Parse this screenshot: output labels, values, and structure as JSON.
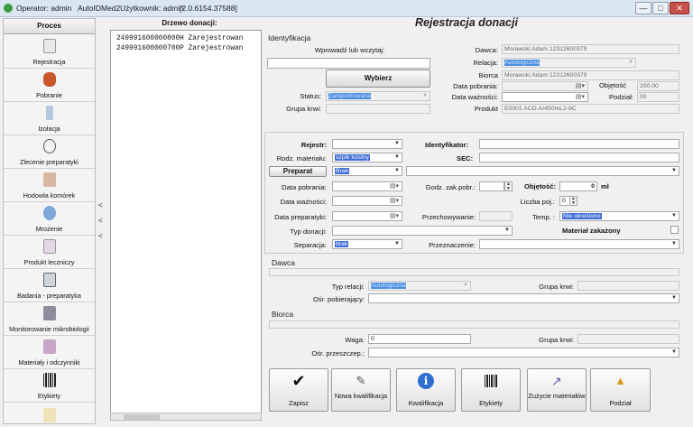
{
  "titlebar": {
    "operator": "Operator: admin",
    "app": "AutoIDMed2",
    "user": "Użytkownik: admin",
    "version": "[2.0.6154.37588]"
  },
  "sidebar": {
    "header": "Proces",
    "items": [
      {
        "label": "Rejestracja",
        "icon": "pen-icon"
      },
      {
        "label": "Pobranie",
        "icon": "blood-bag-icon"
      },
      {
        "label": "Izolacja",
        "icon": "tube-icon"
      },
      {
        "label": "Zlecenie preparatyki",
        "icon": "clock-icon"
      },
      {
        "label": "Hodowla komórek",
        "icon": "cells-icon"
      },
      {
        "label": "Mrożenie",
        "icon": "freeze-icon"
      },
      {
        "label": "Produkt leczniczy",
        "icon": "flask-icon"
      },
      {
        "label": "Badania - preparatyka",
        "icon": "microscope-icon"
      },
      {
        "label": "Monitorowanie mikrobiologii",
        "icon": "lab-icon"
      },
      {
        "label": "Materiały i odczynniki",
        "icon": "reagent-icon"
      },
      {
        "label": "Etykiety",
        "icon": "barcode-icon"
      }
    ]
  },
  "tree": {
    "title": "Drzewo donacji:",
    "items": [
      "249991600000800H Zarejestrowan",
      "249991600000700P Zarejestrowan"
    ]
  },
  "form": {
    "title": "Rejestracja donacji",
    "identification": {
      "section": "Identyfikacja",
      "scan_label": "Wprowadź lub wczytaj:",
      "choose_button": "Wybierz",
      "status_label": "Status:",
      "status_value": "Zarejestrowana",
      "blood_group_label": "Grupa krwi:",
      "donor_label": "Dawca:",
      "donor_value": "Morawski Adam 12312600379",
      "relation_label": "Relacja:",
      "relation_value": "Autologiczna",
      "recipient_label": "Biorca",
      "recipient_value": "Morawski Adam 12312600379",
      "collection_date_label": "Data pobrania:",
      "volume_label": "Objętość",
      "volume_value": "200,00",
      "expiry_label": "Data ważności:",
      "division_label": "Podział:",
      "division_value": "00",
      "product_label": "Produkt",
      "product_value": "E0001    ACD-A/450mL2-8C"
    },
    "details": {
      "register_label": "Rejestr:",
      "identifier_label": "Identyfikator:",
      "material_type_label": "Rodz. materiału:",
      "material_type_value": "szpik kostny",
      "sec_label": "SEC:",
      "preparat_button": "Preparat",
      "preparat_value": "Brak",
      "collection_date_label": "Data pobrania:",
      "end_collection_time_label": "Godz. zak.pobr.:",
      "volume_label": "Objętość:",
      "volume_value": "0",
      "volume_unit": "ml",
      "expiry_label": "Data ważności:",
      "bags_label": "Liczba poj.:",
      "bags_value": "0",
      "prep_date_label": "Data preparatyki:",
      "storage_label": "Przechowywanie:",
      "temp_label": "Temp. :",
      "temp_value": "Nie określono",
      "donation_type_label": "Typ donacji:",
      "infected_label": "Materiał zakażony",
      "separation_label": "Separacja:",
      "separation_value": "brak",
      "purpose_label": "Przeznaczenie:"
    },
    "donor": {
      "section": "Dawca",
      "relation_type_label": "Typ relacji:",
      "relation_type_value": "Autologiczna",
      "blood_group_label": "Grupa krwi:",
      "collection_center_label": "Ośr. pobierający:"
    },
    "recipient": {
      "section": "Biorca",
      "weight_label": "Waga:",
      "weight_value": "0",
      "blood_group_label": "Grupa krwi:",
      "transplant_center_label": "Ośr. przeszczep.:"
    },
    "actions": [
      {
        "label": "Zapisz",
        "icon": "checkmark-icon"
      },
      {
        "label": "Nowa kwalifikacja",
        "icon": "new-document-icon"
      },
      {
        "label": "Kwalifikacja",
        "icon": "info-icon"
      },
      {
        "label": "Etykiety",
        "icon": "barcode-icon"
      },
      {
        "label": "Zużycie materiałów",
        "icon": "syringe-icon"
      },
      {
        "label": "Podział",
        "icon": "split-icon"
      }
    ]
  }
}
